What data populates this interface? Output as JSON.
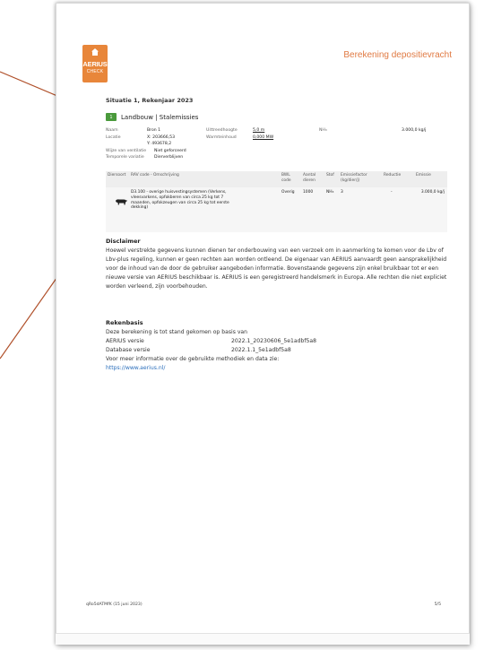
{
  "document": {
    "header_title": "Berekening depositievracht",
    "logo": {
      "brand": "AERIUS",
      "sub": "CHECK",
      "icon": "house-icon",
      "color": "#e8863a"
    },
    "situation_title": "Situatie 1, Rekenjaar 2023",
    "sector": {
      "code": "1",
      "label": "Landbouw | Stalemissies",
      "color": "#4a9a3c"
    },
    "meta": {
      "naam_label": "Naam",
      "naam_value": "Bron 1",
      "locatie_label": "Locatie",
      "locatie_x": "X: 203666,53",
      "locatie_y": "Y: 493678,2",
      "uittreedhoogte_label": "Uittreedhoogte",
      "uittreedhoogte_value": "5,0 m",
      "warmteinhoud_label": "Warmteinhoud",
      "warmteinhoud_value": "0,000 MW",
      "nh3_label": "NH₃",
      "nh3_value": "3.000,0 kg/j",
      "wijze_label": "Wijze van ventilatie",
      "wijze_value": "Niet geforceerd",
      "temporele_label": "Temporele variatie",
      "temporele_value": "Dierverblijven"
    },
    "table": {
      "headers": [
        "Diersoort",
        "RAV code - Omschrijving",
        "BWL code",
        "Aantal dieren",
        "Stof",
        "Emissiefactor (kg/dier/j)",
        "Reductie",
        "Emissie"
      ],
      "row": {
        "icon": "cow-icon",
        "description": "D3.100 - overige huisvestingsystemen (Verkens, vleesvarkens, opfokberen van circa 25 kg tot 7 maanden, opfokzeugen van circa 25 kg tot eerste dekking)",
        "bwl": "Overig",
        "aantal": "1000",
        "stof": "NH₃",
        "emissiefactor": "3",
        "reductie": "-",
        "emissie": "3.000,0 kg/j"
      }
    },
    "disclaimer": {
      "title": "Disclaimer",
      "text": "Hoewel verstrekte gegevens kunnen dienen ter onderbouwing van een verzoek om in aanmerking te komen voor de Lbv of Lbv-plus regeling, kunnen er geen rechten aan worden ontleend. De eigenaar van AERIUS aanvaardt geen aansprakelijkheid voor de inhoud van de door de gebruiker aangeboden informatie. Bovenstaande gegevens zijn enkel bruikbaar tot er een nieuwe versie van AERIUS beschikbaar is. AERIUS is een geregistreerd handelsmerk in Europa. Alle rechten die niet expliciet worden verleend, zijn voorbehouden."
    },
    "rekenbasis": {
      "title": "Rekenbasis",
      "intro": "Deze berekening is tot stand gekomen op basis van",
      "aerius_label": "AERIUS versie",
      "aerius_value": "2022.1_20230606_5e1adbf5a8",
      "db_label": "Database versie",
      "db_value": "2022.1.1_5e1adbf5a8",
      "more_info": "Voor meer informatie over de gebruikte methodiek en data zie:",
      "url": "https://www.aerius.nl/"
    },
    "footer": {
      "reference": "qRo5dATMfK (15 juni 2023)",
      "page": "5/5"
    }
  },
  "colors": {
    "accent": "#e07a43",
    "leader_line": "#b0502a",
    "link": "#2a6ebb"
  }
}
